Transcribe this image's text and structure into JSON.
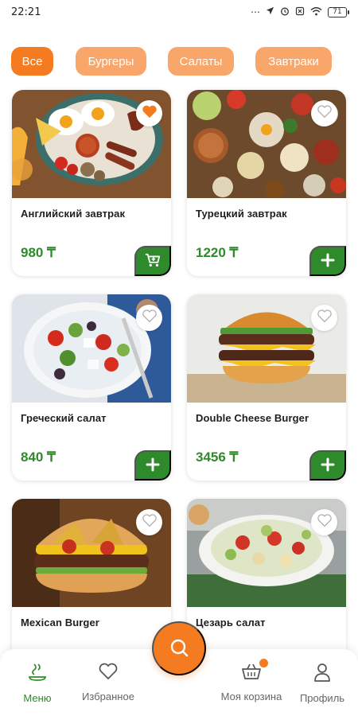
{
  "status": {
    "time": "22:21",
    "icons": [
      "dots-icon",
      "location-icon",
      "alarm-icon",
      "sim-icon",
      "wifi-icon"
    ],
    "battery": "71"
  },
  "categories": [
    {
      "label": "Все",
      "active": true
    },
    {
      "label": "Бургеры",
      "active": false
    },
    {
      "label": "Салаты",
      "active": false
    },
    {
      "label": "Завтраки",
      "active": false
    }
  ],
  "products": [
    {
      "name": "Английский завтрак",
      "price": "980 ₸",
      "favorite": true,
      "action": "cart-add-icon"
    },
    {
      "name": "Турецкий завтрак",
      "price": "1220 ₸",
      "favorite": false,
      "action": "plus-icon"
    },
    {
      "name": "Греческий салат",
      "price": "840 ₸",
      "favorite": false,
      "action": "plus-icon"
    },
    {
      "name": "Double Cheese Burger",
      "price": "3456 ₸",
      "favorite": false,
      "action": "plus-icon"
    },
    {
      "name": "Mexican Burger",
      "price": "",
      "favorite": false
    },
    {
      "name": "Цезарь салат",
      "price": "",
      "favorite": false
    }
  ],
  "nav": {
    "items": [
      {
        "label": "Меню",
        "icon": "menu-dish-icon",
        "active": true
      },
      {
        "label": "Избранное",
        "icon": "heart-icon",
        "active": false
      },
      {
        "label": "Моя корзина",
        "icon": "basket-icon",
        "active": false
      },
      {
        "label": "Профиль",
        "icon": "profile-icon",
        "active": false
      }
    ],
    "search_icon": "search-icon"
  },
  "colors": {
    "accent": "#f47b20",
    "chip": "#f9a66b",
    "green": "#2f8a2b"
  }
}
